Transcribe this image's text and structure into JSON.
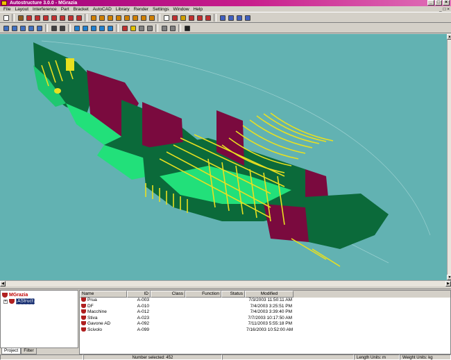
{
  "window": {
    "title": "Autostructure 3.0.0 - MGrazia"
  },
  "window_controls": {
    "minimize": "_",
    "maximize": "□",
    "close": "×"
  },
  "menu": {
    "items": [
      "File",
      "Layout",
      "Interference",
      "Part",
      "Bracket",
      "AutoCAD",
      "Library",
      "Render",
      "Settings",
      "Window",
      "Help"
    ],
    "system": "_ □ ×"
  },
  "toolbar1": [
    {
      "icon": "new-icon",
      "color": "#ffffff"
    },
    {
      "icon": "hammer-icon",
      "color": "#8a5a20"
    },
    {
      "icon": "part-icon",
      "color": "#c03030"
    },
    {
      "icon": "bracket-icon",
      "color": "#c03030"
    },
    {
      "icon": "plate-icon",
      "color": "#c03030"
    },
    {
      "icon": "stiffener-icon",
      "color": "#c03030"
    },
    {
      "icon": "frame-icon",
      "color": "#c03030"
    },
    {
      "icon": "profile-icon",
      "color": "#c03030"
    },
    {
      "icon": "cut-icon",
      "color": "#c03030"
    },
    {
      "icon": "cube-icon",
      "color": "#d08000"
    },
    {
      "icon": "layer-icon",
      "color": "#d08000"
    },
    {
      "icon": "grid-icon",
      "color": "#d08000"
    },
    {
      "icon": "box-icon",
      "color": "#d08000"
    },
    {
      "icon": "panel-icon",
      "color": "#d08000"
    },
    {
      "icon": "shell-icon",
      "color": "#d08000"
    },
    {
      "icon": "deck-icon",
      "color": "#d08000"
    },
    {
      "icon": "block-icon",
      "color": "#d08000"
    },
    {
      "icon": "chat-icon",
      "color": "#ffffff"
    },
    {
      "icon": "weld-icon",
      "color": "#c03030"
    },
    {
      "icon": "lock-icon",
      "color": "#d0a000"
    },
    {
      "icon": "nest-icon",
      "color": "#c03030"
    },
    {
      "icon": "report-icon",
      "color": "#c03030"
    },
    {
      "icon": "export-icon",
      "color": "#c03030"
    },
    {
      "icon": "view-front-icon",
      "color": "#4060c0"
    },
    {
      "icon": "view-side-icon",
      "color": "#4060c0"
    },
    {
      "icon": "view-top-icon",
      "color": "#4060c0"
    },
    {
      "icon": "view-iso-icon",
      "color": "#4060c0"
    }
  ],
  "toolbar2": [
    {
      "icon": "zoom-in-icon",
      "color": "#4070c0"
    },
    {
      "icon": "zoom-out-icon",
      "color": "#4070c0"
    },
    {
      "icon": "zoom-window-icon",
      "color": "#4070c0"
    },
    {
      "icon": "zoom-extents-icon",
      "color": "#4070c0"
    },
    {
      "icon": "zoom-previous-icon",
      "color": "#4070c0"
    },
    {
      "icon": "eye-icon",
      "color": "#404040"
    },
    {
      "icon": "hide-icon",
      "color": "#404040"
    },
    {
      "icon": "cube-front-icon",
      "color": "#2080d0"
    },
    {
      "icon": "cube-top-icon",
      "color": "#2080d0"
    },
    {
      "icon": "cube-left-icon",
      "color": "#2080d0"
    },
    {
      "icon": "cube-right-icon",
      "color": "#2080d0"
    },
    {
      "icon": "cube-iso-icon",
      "color": "#2080d0"
    },
    {
      "icon": "shade-icon",
      "color": "#c03030"
    },
    {
      "icon": "light-icon",
      "color": "#e0c000"
    },
    {
      "icon": "wire-icon",
      "color": "#808080"
    },
    {
      "icon": "render-icon",
      "color": "#808080"
    },
    {
      "icon": "print-icon",
      "color": "#808080"
    },
    {
      "icon": "refresh-icon",
      "color": "#808080"
    },
    {
      "icon": "cursor-icon",
      "color": "#202020"
    }
  ],
  "tree": {
    "root": "MGrazia",
    "child": "AStruct",
    "expander": "+"
  },
  "tabs": [
    "Project",
    "Filter"
  ],
  "list": {
    "columns": [
      "Name",
      "ID",
      "Class",
      "Function",
      "Status",
      "Modified"
    ],
    "rows": [
      {
        "name": "Prua",
        "id": "A-003",
        "class": "",
        "function": "",
        "status": "",
        "modified": "7/3/2003 11:50:11 AM"
      },
      {
        "name": "DF",
        "id": "A-010",
        "class": "",
        "function": "",
        "status": "",
        "modified": "7/4/2003 3:25:51 PM"
      },
      {
        "name": "Macchine",
        "id": "A-012",
        "class": "",
        "function": "",
        "status": "",
        "modified": "7/4/2003 3:39:40 PM"
      },
      {
        "name": "Stiva",
        "id": "A-023",
        "class": "",
        "function": "",
        "status": "",
        "modified": "7/7/2003 10:17:50 AM"
      },
      {
        "name": "Gavone AD",
        "id": "A-092",
        "class": "",
        "function": "",
        "status": "",
        "modified": "7/11/2003 5:55:18 PM"
      },
      {
        "name": "Scivolo",
        "id": "A-099",
        "class": "",
        "function": "",
        "status": "",
        "modified": "7/16/2003 10:52:00 AM"
      }
    ]
  },
  "status": {
    "left": "",
    "selected": "Number selected: 452",
    "mid": "",
    "length_units": "Length Units: m",
    "weight_units": "Weight Units: kg"
  },
  "colors": {
    "hull": "#0b6a3a",
    "bulkhead": "#7a0a3e",
    "deck": "#22e07a",
    "frames": "#e8e020",
    "background": "#62b2b2"
  }
}
